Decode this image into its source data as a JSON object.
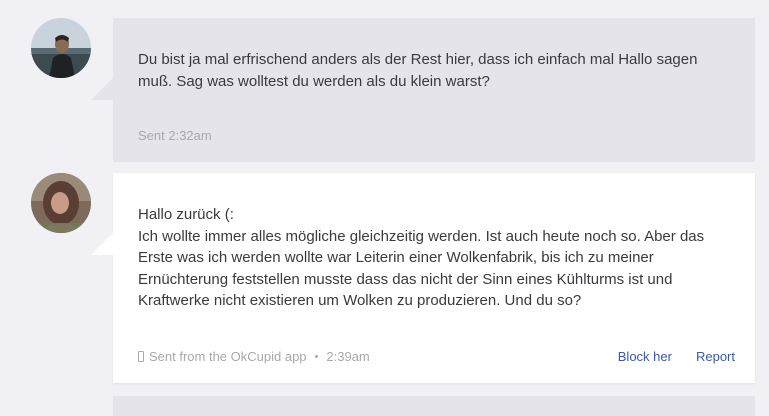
{
  "messages": [
    {
      "avatar_icon": "user-photo-man",
      "text": "Du bist ja mal erfrischend anders als der Rest hier, dass ich einfach mal Hallo sagen muß. Sag was wolltest du werden als du klein warst?",
      "sent_label": "Sent 2:32am"
    },
    {
      "avatar_icon": "user-photo-woman",
      "text": "Hallo zurück (:\nIch wollte immer alles mögliche gleichzeitig werden. Ist auch heute noch so. Aber das Erste was ich werden wollte war Leiterin einer Wolkenfabrik, bis ich zu meiner Ernüchterung feststellen musste dass das nicht der Sinn eines Kühlturms ist und Kraftwerke nicht existieren um Wolken zu produzieren. Und du so?",
      "source_label": "Sent from the OkCupid app",
      "separator": "•",
      "time_label": "2:39am",
      "actions": {
        "block_label": "Block her",
        "report_label": "Report"
      }
    }
  ],
  "colors": {
    "page_bg": "#f0f0f5",
    "received_bubble": "#e4e4ea",
    "sent_bubble": "#ffffff",
    "link": "#3b57b4",
    "meta": "#a8a8ad"
  }
}
